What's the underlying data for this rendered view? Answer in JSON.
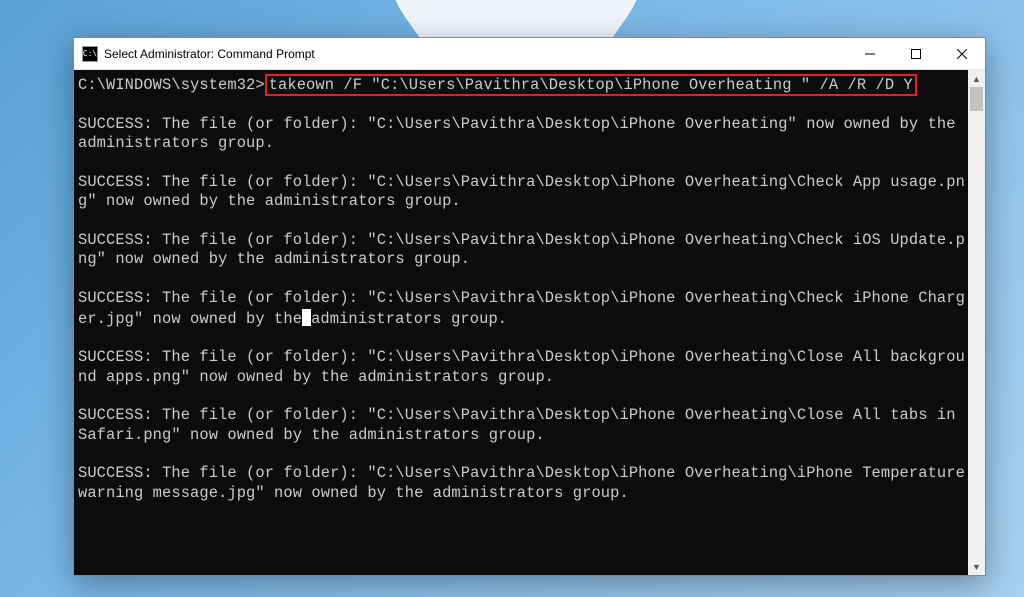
{
  "window": {
    "title": "Select Administrator: Command Prompt",
    "icon_label": "C:\\"
  },
  "prompt": {
    "path": "C:\\WINDOWS\\system32>",
    "command": "takeown /F \"C:\\Users\\Pavithra\\Desktop\\iPhone Overheating \" /A /R /D Y"
  },
  "cursor_line": {
    "before": "rger.jpg\" now owned by the",
    "after": "administrators group."
  },
  "outputs": [
    "SUCCESS: The file (or folder): \"C:\\Users\\Pavithra\\Desktop\\iPhone Overheating\" now owned by the administrators group.",
    "SUCCESS: The file (or folder): \"C:\\Users\\Pavithra\\Desktop\\iPhone Overheating\\Check App usage.png\" now owned by the administrators group.",
    "SUCCESS: The file (or folder): \"C:\\Users\\Pavithra\\Desktop\\iPhone Overheating\\Check iOS Update.png\" now owned by the administrators group.",
    "SUCCESS: The file (or folder): \"C:\\Users\\Pavithra\\Desktop\\iPhone Overheating\\Check iPhone Charger.jpg\" now owned by the administrators group.",
    "SUCCESS: The file (or folder): \"C:\\Users\\Pavithra\\Desktop\\iPhone Overheating\\Close All background apps.png\" now owned by the administrators group.",
    "SUCCESS: The file (or folder): \"C:\\Users\\Pavithra\\Desktop\\iPhone Overheating\\Close All tabs in Safari.png\" now owned by the administrators group.",
    "SUCCESS: The file (or folder): \"C:\\Users\\Pavithra\\Desktop\\iPhone Overheating\\iPhone Temperature warning message.jpg\" now owned by the administrators group."
  ]
}
